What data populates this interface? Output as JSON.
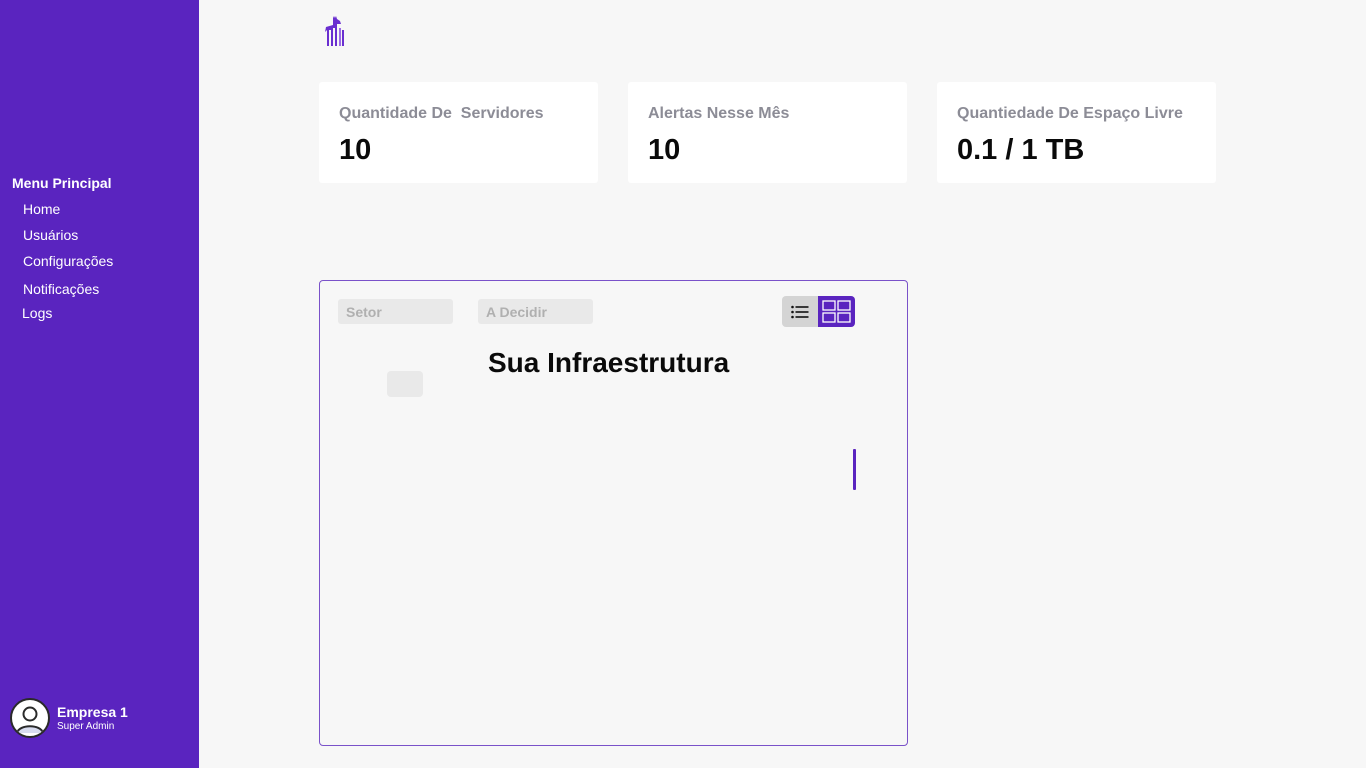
{
  "sidebar": {
    "menu_title": "Menu Principal",
    "items": [
      {
        "label": "Home"
      },
      {
        "label": "Usuários"
      },
      {
        "label": "Configurações"
      },
      {
        "label": "Notificações"
      },
      {
        "label": "Logs"
      }
    ],
    "profile": {
      "name": "Empresa 1",
      "role": "Super Admin",
      "icon": "user-avatar-icon"
    }
  },
  "logo": {
    "icon": "giraffe-logo-icon"
  },
  "cards": [
    {
      "label": "Quantidade De  Servidores",
      "value": "10"
    },
    {
      "label": "Alertas Nesse Mês",
      "value": "10"
    },
    {
      "label": "Quantiedade De Espaço Livre",
      "value": "0.1 / 1 TB"
    }
  ],
  "panel": {
    "filter_sector": "Setor",
    "filter_decide": "A Decidir",
    "title": "Sua Infraestrutura",
    "view_list_icon": "list-view-icon",
    "view_grid_icon": "grid-view-icon"
  },
  "colors": {
    "sidebar_bg": "#5a24bf",
    "accent": "#5a24bf",
    "page_bg": "#f7f7f7",
    "card_label": "#8c8c96"
  }
}
